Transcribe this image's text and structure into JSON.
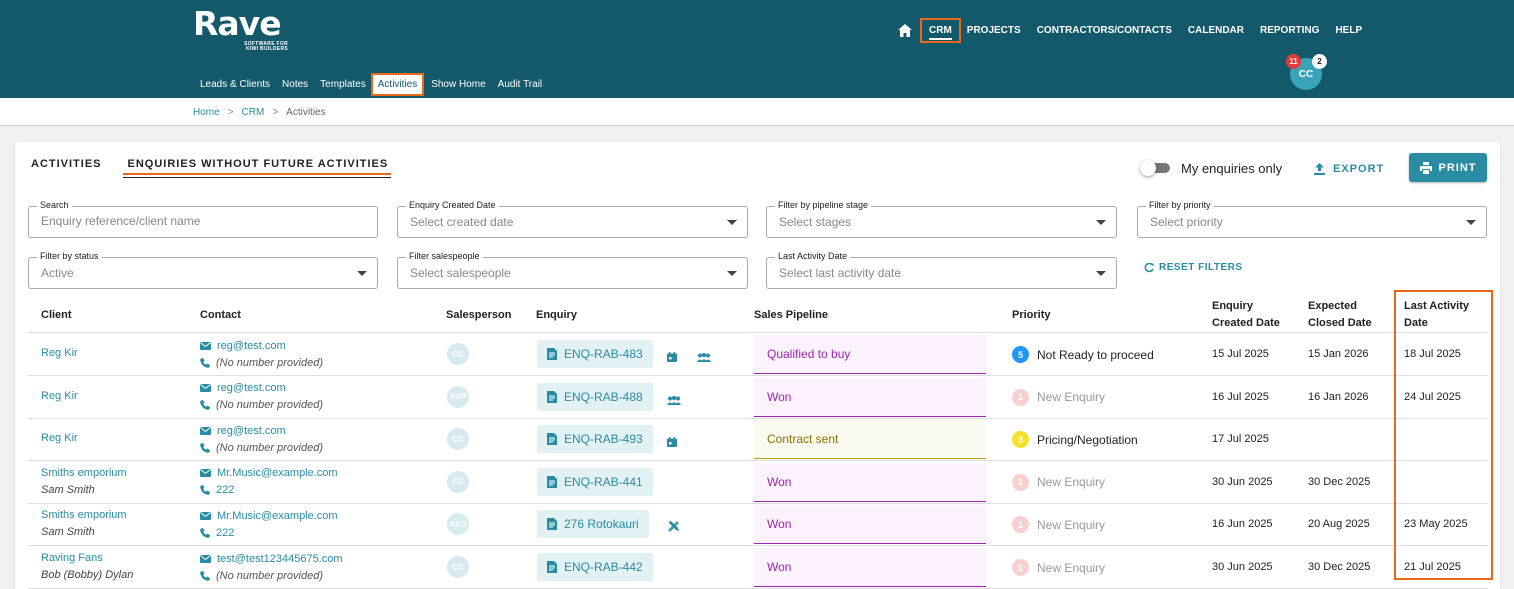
{
  "app": {
    "logo": "Rave",
    "logo_tagline_1": "SOFTWARE FOR",
    "logo_tagline_2": "KIWI BUILDERS"
  },
  "top_nav": [
    {
      "label": "CRM",
      "active": true
    },
    {
      "label": "PROJECTS"
    },
    {
      "label": "CONTRACTORS/CONTACTS"
    },
    {
      "label": "CALENDAR"
    },
    {
      "label": "REPORTING"
    },
    {
      "label": "HELP"
    }
  ],
  "sub_nav": [
    {
      "label": "Leads & Clients"
    },
    {
      "label": "Notes"
    },
    {
      "label": "Templates"
    },
    {
      "label": "Activities",
      "active": true
    },
    {
      "label": "Show Home"
    },
    {
      "label": "Audit Trail"
    }
  ],
  "user": {
    "initials": "CC",
    "notifications": "11",
    "messages": "2"
  },
  "breadcrumb": {
    "home": "Home",
    "crm": "CRM",
    "current": "Activities"
  },
  "tabs": [
    {
      "label": "ACTIVITIES"
    },
    {
      "label": "ENQUIRIES WITHOUT FUTURE ACTIVITIES",
      "active": true
    }
  ],
  "toolbar": {
    "my_enquiries_label": "My enquiries only",
    "export_label": "EXPORT",
    "print_label": "PRINT"
  },
  "filters": {
    "search": {
      "label": "Search",
      "placeholder": "Enquiry reference/client name"
    },
    "created_date": {
      "label": "Enquiry Created Date",
      "placeholder": "Select created date"
    },
    "pipeline_stage": {
      "label": "Filter by pipeline stage",
      "placeholder": "Select stages"
    },
    "priority": {
      "label": "Filter by priority",
      "placeholder": "Select priority"
    },
    "status": {
      "label": "Filter by status",
      "value": "Active"
    },
    "salespeople": {
      "label": "Filter salespeople",
      "placeholder": "Select salespeople"
    },
    "last_activity": {
      "label": "Last Activity Date",
      "placeholder": "Select last activity date"
    },
    "reset_label": "RESET FILTERS"
  },
  "table": {
    "headers": {
      "client": "Client",
      "contact": "Contact",
      "salesperson": "Salesperson",
      "enquiry": "Enquiry",
      "pipeline": "Sales Pipeline",
      "priority": "Priority",
      "created_1": "Enquiry",
      "created_2": "Created Date",
      "expected_1": "Expected",
      "expected_2": "Closed Date",
      "last_1": "Last Activity",
      "last_2": "Date"
    },
    "rows": [
      {
        "client": "Reg Kir",
        "sub": "",
        "email": "reg@test.com",
        "phone": "(No number provided)",
        "has_phone": false,
        "sp": "CC",
        "enquiry": "ENQ-RAB-483",
        "icons": [
          "calendar-icon",
          "people-icon"
        ],
        "pipeline": "Qualified to buy",
        "pipe_style": "purple",
        "prio_num": "5",
        "prio_label": "Not Ready to proceed",
        "prio_color": "#2196f3",
        "prio_active": true,
        "created": "15 Jul 2025",
        "expected": "15 Jan 2026",
        "last": "18 Jul 2025"
      },
      {
        "client": "Reg Kir",
        "sub": "",
        "email": "reg@test.com",
        "phone": "(No number provided)",
        "has_phone": false,
        "sp": "ASP",
        "enquiry": "ENQ-RAB-488",
        "icons": [
          "people-icon"
        ],
        "pipeline": "Won",
        "pipe_style": "purple",
        "prio_num": "1",
        "prio_label": "New Enquiry",
        "prio_color": "#f8d0d0",
        "prio_active": false,
        "created": "16 Jul 2025",
        "expected": "16 Jan 2026",
        "last": "24 Jul 2025"
      },
      {
        "client": "Reg Kir",
        "sub": "",
        "email": "reg@test.com",
        "phone": "(No number provided)",
        "has_phone": false,
        "sp": "CC",
        "enquiry": "ENQ-RAB-493",
        "icons": [
          "calendar-icon"
        ],
        "pipeline": "Contract sent",
        "pipe_style": "yellow",
        "prio_num": "3",
        "prio_label": "Pricing/Negotiation",
        "prio_color": "#f5e12b",
        "prio_active": true,
        "created": "17 Jul 2025",
        "expected": "",
        "last": ""
      },
      {
        "client": "Smiths emporium",
        "sub": "Sam Smith",
        "email": "Mr.Music@example.com",
        "phone": "222",
        "has_phone": true,
        "sp": "CC",
        "enquiry": "ENQ-RAB-441",
        "icons": [],
        "pipeline": "Won",
        "pipe_style": "purple",
        "prio_num": "1",
        "prio_label": "New Enquiry",
        "prio_color": "#f8d0d0",
        "prio_active": false,
        "created": "30 Jun 2025",
        "expected": "30 Dec 2025",
        "last": ""
      },
      {
        "client": "Smiths emporium",
        "sub": "Sam Smith",
        "email": "Mr.Music@example.com",
        "phone": "222",
        "has_phone": true,
        "sp": "ABO",
        "enquiry": "276 Rotokauri",
        "icons": [
          "tools-icon"
        ],
        "pipeline": "Won",
        "pipe_style": "purple",
        "prio_num": "1",
        "prio_label": "New Enquiry",
        "prio_color": "#f8d0d0",
        "prio_active": false,
        "created": "16 Jun 2025",
        "expected": "20 Aug 2025",
        "last": "23 May 2025"
      },
      {
        "client": "Raving Fans",
        "sub": "Bob (Bobby) Dylan",
        "email": "test@test123445675.com",
        "phone": "(No number provided)",
        "has_phone": false,
        "sp": "CC",
        "enquiry": "ENQ-RAB-442",
        "icons": [],
        "pipeline": "Won",
        "pipe_style": "purple",
        "prio_num": "1",
        "prio_label": "New Enquiry",
        "prio_color": "#f8d0d0",
        "prio_active": false,
        "created": "30 Jun 2025",
        "expected": "30 Dec 2025",
        "last": "21 Jul 2025"
      }
    ]
  },
  "colors": {
    "header_bg": "#13586b",
    "accent": "#2a8ca3",
    "highlight": "#e8681c"
  }
}
